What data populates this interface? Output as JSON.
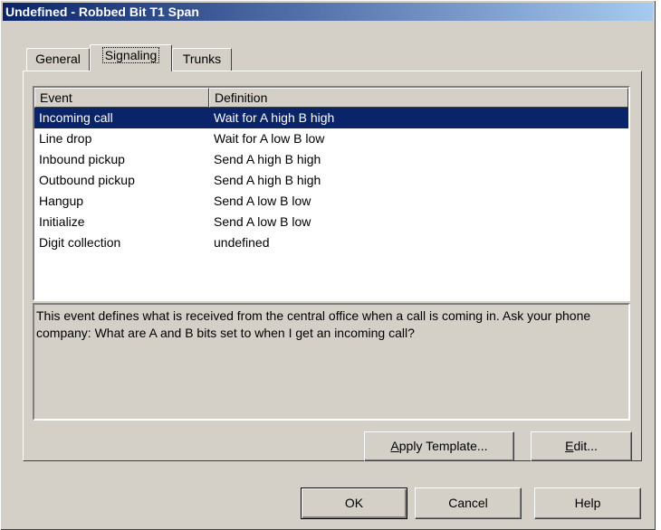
{
  "window": {
    "title": "Undefined - Robbed Bit T1 Span"
  },
  "tabs": [
    {
      "label": "General"
    },
    {
      "label": "Signaling"
    },
    {
      "label": "Trunks"
    }
  ],
  "list": {
    "headers": [
      "Event",
      "Definition"
    ],
    "rows": [
      {
        "event": "Incoming call",
        "definition": "Wait for A high B high"
      },
      {
        "event": "Line drop",
        "definition": "Wait for A low B low"
      },
      {
        "event": "Inbound pickup",
        "definition": "Send A high B high"
      },
      {
        "event": "Outbound pickup",
        "definition": "Send A high B high"
      },
      {
        "event": "Hangup",
        "definition": "Send A low B low"
      },
      {
        "event": "Initialize",
        "definition": "Send A low B low"
      },
      {
        "event": "Digit collection",
        "definition": "undefined"
      }
    ]
  },
  "description": "This event defines what is received from the central office when a call is coming in.  Ask your phone company: What are A and B bits set to when I get an incoming call?",
  "buttons": {
    "apply_template": {
      "mnemonic": "A",
      "rest": "pply Template..."
    },
    "edit": {
      "mnemonic": "E",
      "rest": "dit..."
    },
    "ok": "OK",
    "cancel": "Cancel",
    "help": "Help"
  },
  "colors": {
    "selection": "#0a246a",
    "face": "#d4d0c8"
  }
}
